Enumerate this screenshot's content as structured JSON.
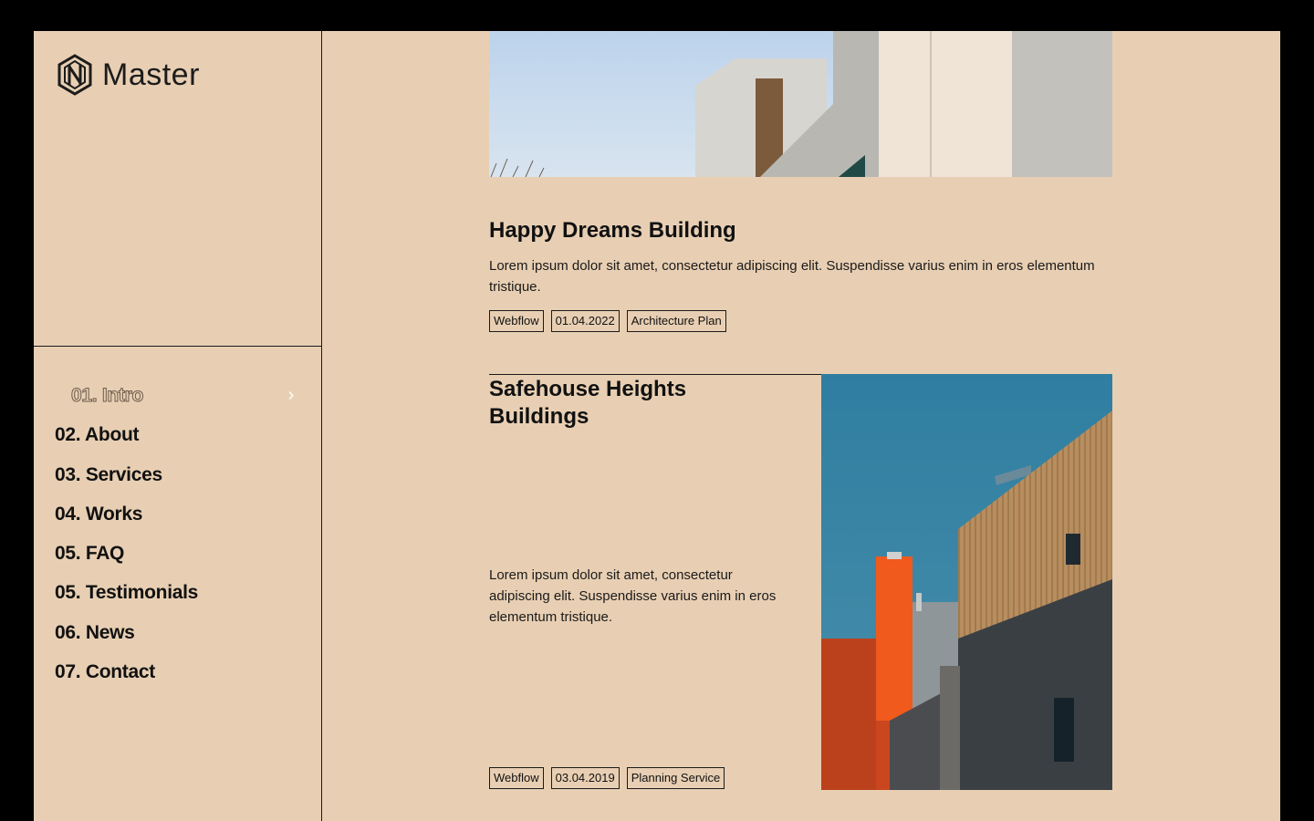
{
  "brand": {
    "name": "Master",
    "logo_icon": "hexagon-logo-icon"
  },
  "nav": {
    "items": [
      {
        "label": "01. Intro",
        "active": true
      },
      {
        "label": "02. About"
      },
      {
        "label": "03. Services"
      },
      {
        "label": "04. Works"
      },
      {
        "label": "05. FAQ"
      },
      {
        "label": "05. Testimonials"
      },
      {
        "label": "06. News"
      },
      {
        "label": "07. Contact"
      }
    ],
    "active_icon": "chevron-right-icon"
  },
  "projects": [
    {
      "title": "Happy Dreams Building",
      "description": "Lorem ipsum dolor sit amet, consectetur adipiscing elit. Suspendisse varius enim in eros elementum tristique.",
      "tags": [
        "Webflow",
        "01.04.2022",
        "Architecture Plan"
      ]
    },
    {
      "title": "Safehouse Heights Buildings",
      "description": "Lorem ipsum dolor sit amet, consectetur adipiscing elit. Suspendisse varius enim in eros elementum tristique.",
      "tags": [
        "Webflow",
        "03.04.2019",
        "Planning Service"
      ]
    }
  ],
  "colors": {
    "background": "#e8cfb3",
    "text": "#111111",
    "frame": "#000000"
  }
}
